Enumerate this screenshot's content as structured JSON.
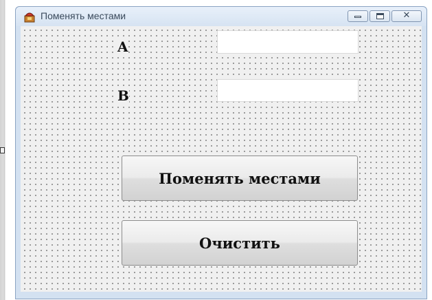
{
  "window": {
    "title": "Поменять местами",
    "icon": "app-icon",
    "caption_buttons": {
      "minimize_icon": "minimize-icon",
      "maximize_icon": "maximize-icon",
      "close_symbol": "✕"
    }
  },
  "form": {
    "label_a": "A",
    "label_b": "B",
    "field_a": {
      "value": "",
      "placeholder": ""
    },
    "field_b": {
      "value": "",
      "placeholder": ""
    },
    "swap_button": "Поменять местами",
    "clear_button": "Очистить"
  },
  "colors": {
    "title_bar": "#d6e3f2",
    "client_background": "#f0f0f0",
    "grid_dots": "#2a2a2a"
  }
}
